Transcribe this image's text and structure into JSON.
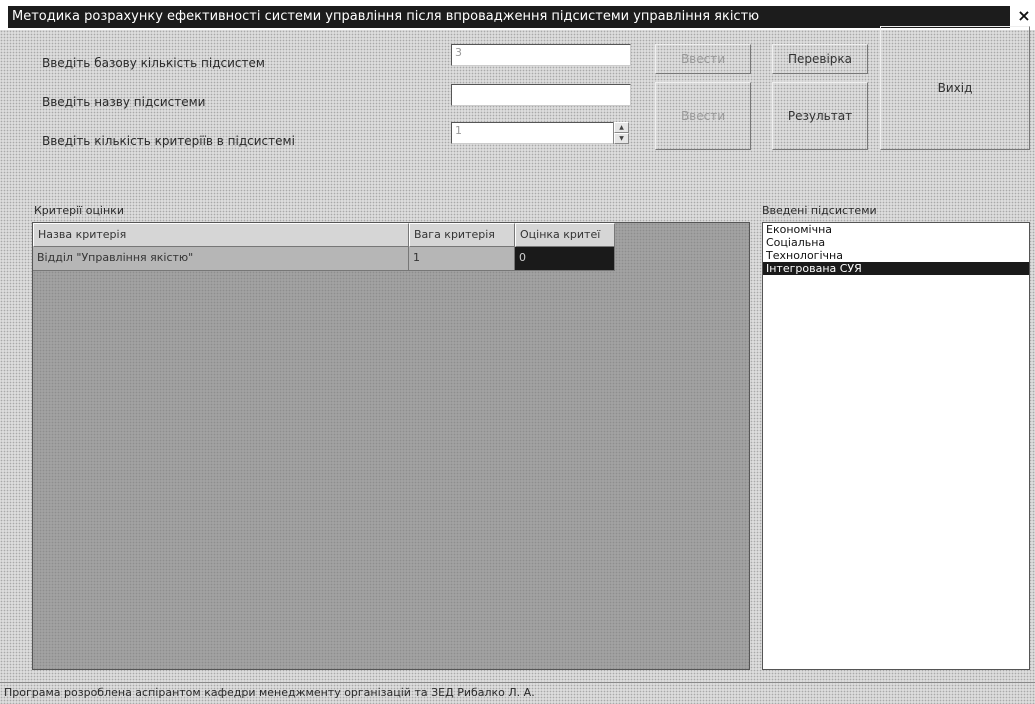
{
  "window": {
    "title": "Методика розрахунку ефективності системи управління після впровадження підсистеми управління якістю",
    "close_label": "×"
  },
  "form": {
    "base_count_label": "Введіть базову кількість підсистем",
    "base_count_value": "3",
    "subsystem_name_label": "Введіть назву підсистеми",
    "subsystem_name_value": "",
    "criteria_count_label": "Введіть кількість критеріїв в підсистемі",
    "criteria_count_value": "1"
  },
  "buttons": {
    "enter1": "Ввести",
    "enter2": "Ввести",
    "check": "Перевірка",
    "result": "Результат",
    "exit": "Вихід"
  },
  "criteria": {
    "section_label": "Критерії оцінки",
    "columns": [
      "Назва критерія",
      "Вага критерія",
      "Оцінка критеї"
    ],
    "rows": [
      {
        "name": "Відділ \"Управління якістю\"",
        "weight": "1",
        "score": "0"
      }
    ]
  },
  "subsystems": {
    "section_label": "Введені підсистеми",
    "items": [
      "Економічна",
      "Соціальна",
      "Технологічна",
      "Інтегрована СУЯ"
    ],
    "selected_index": 3
  },
  "footer": {
    "text": "Програма розроблена аспірантом кафедри менеджменту організацій та ЗЕД Рибалко Л. А."
  },
  "icons": {
    "spin_up": "spin-up-arrow-icon",
    "spin_down": "spin-down-arrow-icon"
  }
}
